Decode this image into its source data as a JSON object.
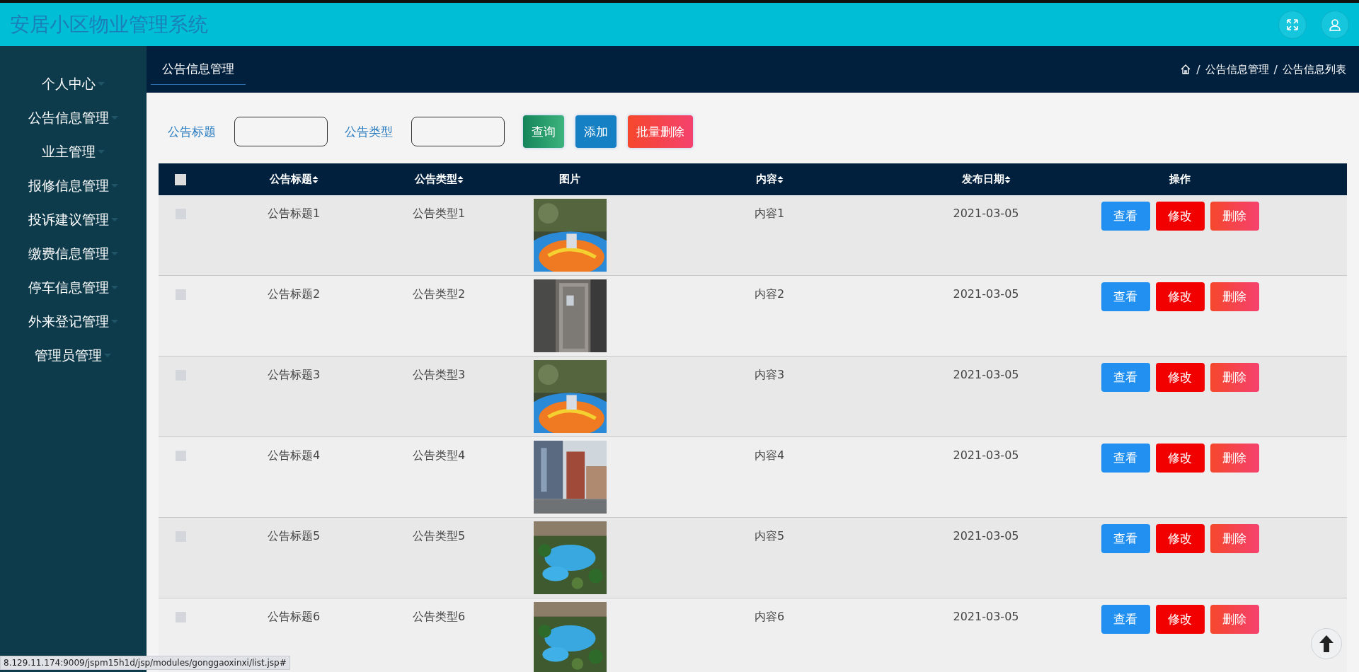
{
  "header": {
    "title": "安居小区物业管理系统"
  },
  "sidebar": {
    "items": [
      {
        "label": "个人中心"
      },
      {
        "label": "公告信息管理"
      },
      {
        "label": "业主管理"
      },
      {
        "label": "报修信息管理"
      },
      {
        "label": "投诉建议管理"
      },
      {
        "label": "缴费信息管理"
      },
      {
        "label": "停车信息管理"
      },
      {
        "label": "外来登记管理"
      },
      {
        "label": "管理员管理"
      }
    ]
  },
  "tabs": [
    {
      "label": "公告信息管理",
      "selected": true
    }
  ],
  "breadcrumb": [
    {
      "text": "/",
      "kind": "separator"
    },
    {
      "text": "公告信息管理",
      "kind": "item"
    },
    {
      "text": "/",
      "kind": "separator"
    },
    {
      "text": "公告信息列表",
      "kind": "item"
    }
  ],
  "search": {
    "fields": [
      {
        "label": "公告标题"
      },
      {
        "label": "公告类型"
      }
    ],
    "buttons": [
      {
        "label": "查询",
        "kind": "search"
      },
      {
        "label": "添加",
        "kind": "add"
      },
      {
        "label": "批量删除",
        "kind": "batch-delete"
      }
    ]
  },
  "table": {
    "header_checked": false,
    "columns": [
      {
        "label": "公告标题",
        "sortable": true
      },
      {
        "label": "公告类型",
        "sortable": true
      },
      {
        "label": "图片",
        "sortable": false
      },
      {
        "label": "内容",
        "sortable": true
      },
      {
        "label": "发布日期",
        "sortable": true
      },
      {
        "label": "操作",
        "sortable": false
      }
    ],
    "rows": [
      {
        "checked": false,
        "title": "公告标题1",
        "type": "公告类型1",
        "image": {
          "kind": "picture"
        },
        "content": "内容1",
        "date": "2021-03-05",
        "actions": [
          {
            "label": "查看",
            "kind": "view"
          },
          {
            "label": "修改",
            "kind": "edit"
          },
          {
            "label": "删除",
            "kind": "delete"
          }
        ]
      },
      {
        "checked": false,
        "title": "公告标题2",
        "type": "公告类型2",
        "image": {
          "kind": "picture"
        },
        "content": "内容2",
        "date": "2021-03-05",
        "actions": [
          {
            "label": "查看",
            "kind": "view"
          },
          {
            "label": "修改",
            "kind": "edit"
          },
          {
            "label": "删除",
            "kind": "delete"
          }
        ]
      },
      {
        "checked": false,
        "title": "公告标题3",
        "type": "公告类型3",
        "image": {
          "kind": "picture"
        },
        "content": "内容3",
        "date": "2021-03-05",
        "actions": [
          {
            "label": "查看",
            "kind": "view"
          },
          {
            "label": "修改",
            "kind": "edit"
          },
          {
            "label": "删除",
            "kind": "delete"
          }
        ]
      },
      {
        "checked": false,
        "title": "公告标题4",
        "type": "公告类型4",
        "image": {
          "kind": "picture"
        },
        "content": "内容4",
        "date": "2021-03-05",
        "actions": [
          {
            "label": "查看",
            "kind": "view"
          },
          {
            "label": "修改",
            "kind": "edit"
          },
          {
            "label": "删除",
            "kind": "delete"
          }
        ]
      },
      {
        "checked": false,
        "title": "公告标题5",
        "type": "公告类型5",
        "image": {
          "kind": "picture"
        },
        "content": "内容5",
        "date": "2021-03-05",
        "actions": [
          {
            "label": "查看",
            "kind": "view"
          },
          {
            "label": "修改",
            "kind": "edit"
          },
          {
            "label": "删除",
            "kind": "delete"
          }
        ]
      },
      {
        "checked": false,
        "title": "公告标题6",
        "type": "公告类型6",
        "image": {
          "kind": "picture"
        },
        "content": "内容6",
        "date": "2021-03-05",
        "actions": [
          {
            "label": "查看",
            "kind": "view"
          },
          {
            "label": "修改",
            "kind": "edit"
          },
          {
            "label": "删除",
            "kind": "delete"
          }
        ]
      }
    ]
  },
  "status_url": "8.129.11.174:9009/jspm15h1d/jsp/modules/gonggaoxinxi/list.jsp#"
}
